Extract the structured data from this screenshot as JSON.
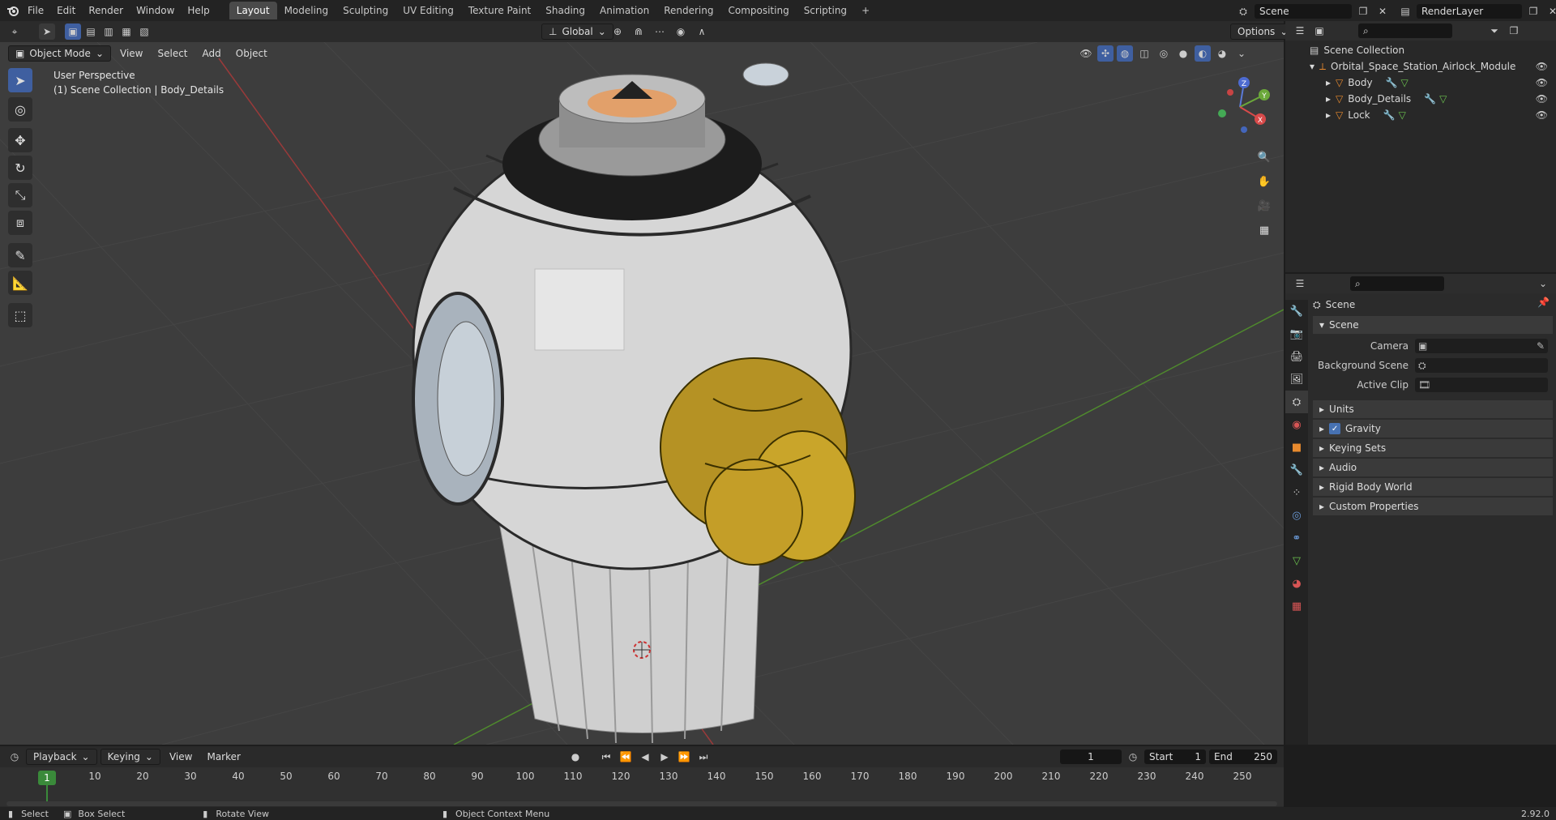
{
  "topbar": {
    "menus": [
      "File",
      "Edit",
      "Render",
      "Window",
      "Help"
    ],
    "workspaces": [
      "Layout",
      "Modeling",
      "Sculpting",
      "UV Editing",
      "Texture Paint",
      "Shading",
      "Animation",
      "Rendering",
      "Compositing",
      "Scripting"
    ],
    "active_workspace": "Layout",
    "scene_name": "Scene",
    "view_layer": "RenderLayer"
  },
  "viewport": {
    "mode": "Object Mode",
    "menus": [
      "View",
      "Select",
      "Add",
      "Object"
    ],
    "transform_orientation": "Global",
    "options_label": "Options",
    "info_line1": "User Perspective",
    "info_line2": "(1) Scene Collection | Body_Details",
    "gizmo_axes": {
      "x": "X",
      "y": "Y",
      "z": "Z"
    }
  },
  "outliner": {
    "root": "Scene Collection",
    "collection": "Orbital_Space_Station_Airlock_Module",
    "objects": [
      "Body",
      "Body_Details",
      "Lock"
    ]
  },
  "properties": {
    "context": "Scene",
    "panel": "Scene",
    "fields": {
      "camera": "Camera",
      "background_scene": "Background Scene",
      "active_clip": "Active Clip"
    },
    "subpanels": [
      "Units",
      "Gravity",
      "Keying Sets",
      "Audio",
      "Rigid Body World",
      "Custom Properties"
    ],
    "gravity_checked": true
  },
  "timeline": {
    "menus": [
      "Playback",
      "Keying",
      "View",
      "Marker"
    ],
    "current_frame": "1",
    "start_label": "Start",
    "start": "1",
    "end_label": "End",
    "end": "250",
    "ticks": [
      "10",
      "20",
      "30",
      "40",
      "50",
      "60",
      "70",
      "80",
      "90",
      "100",
      "110",
      "120",
      "130",
      "140",
      "150",
      "160",
      "170",
      "180",
      "190",
      "200",
      "210",
      "220",
      "230",
      "240",
      "250"
    ],
    "frame_marker": "1"
  },
  "statusbar": {
    "select": "Select",
    "box_select": "Box Select",
    "rotate_view": "Rotate View",
    "context_menu": "Object Context Menu",
    "version": "2.92.0"
  },
  "colors": {
    "accent": "#4772b3",
    "object_orange": "#e88a2e",
    "grid_red": "#a33a3a",
    "grid_green": "#4f8a2d"
  }
}
